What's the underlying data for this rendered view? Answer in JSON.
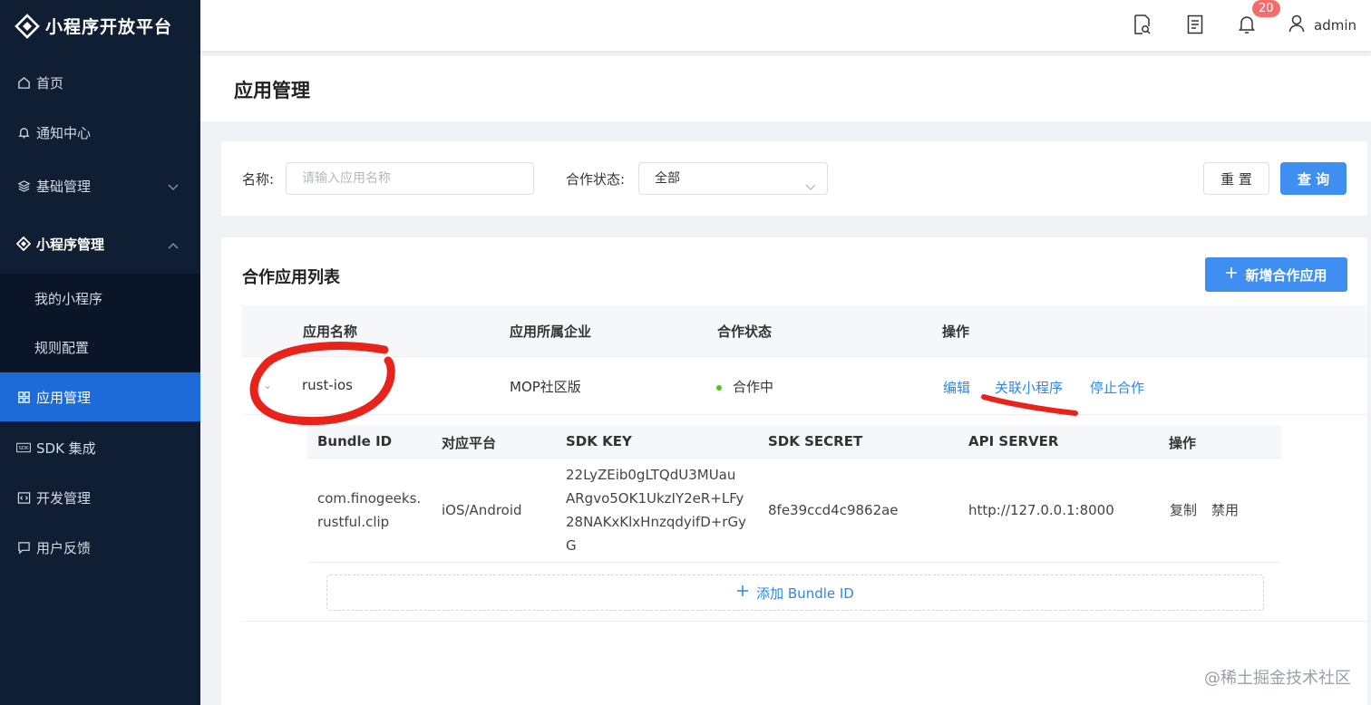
{
  "brand": {
    "title": "小程序开放平台"
  },
  "sidebar": {
    "items": [
      {
        "label": "首页",
        "icon": "home-icon"
      },
      {
        "label": "通知中心",
        "icon": "bell-icon"
      },
      {
        "label": "基础管理",
        "icon": "layers-icon"
      },
      {
        "label": "小程序管理",
        "icon": "miniprogram-icon"
      },
      {
        "label": "我的小程序"
      },
      {
        "label": "规则配置"
      },
      {
        "label": "应用管理",
        "icon": "grid-icon"
      },
      {
        "label": "SDK 集成",
        "icon": "sdk-icon"
      },
      {
        "label": "开发管理",
        "icon": "code-icon"
      },
      {
        "label": "用户反馈",
        "icon": "feedback-icon"
      }
    ]
  },
  "header": {
    "notification_count": "20",
    "username": "admin"
  },
  "page": {
    "title": "应用管理"
  },
  "filter": {
    "name_label": "名称:",
    "name_placeholder": "请输入应用名称",
    "status_label": "合作状态:",
    "status_value": "全部",
    "reset_label": "重 置",
    "query_label": "查 询"
  },
  "list": {
    "title": "合作应用列表",
    "add_label": "新增合作应用",
    "columns": [
      "应用名称",
      "应用所属企业",
      "合作状态",
      "操作"
    ],
    "row": {
      "name": "rust-ios",
      "company": "MOP社区版",
      "status": "合作中",
      "actions": [
        "编辑",
        "关联小程序",
        "停止合作"
      ]
    }
  },
  "bundle_table": {
    "columns": [
      "Bundle ID",
      "对应平台",
      "SDK KEY",
      "SDK SECRET",
      "API SERVER",
      "操作"
    ],
    "row": {
      "bundle_id_line1": "com.finogeeks.",
      "bundle_id_line2": "rustful.clip",
      "platform": "iOS/Android",
      "sdk_key_lines": [
        "22LyZEib0gLTQdU3MUau",
        "ARgvo5OK1UkzIY2eR+LFy",
        "28NAKxKlxHnzqdyifD+rGy",
        "G"
      ],
      "sdk_secret": "8fe39ccd4c9862ae",
      "api_server": "http://127.0.0.1:8000",
      "copy_label": "复制",
      "disable_label": "禁用"
    },
    "add_label": "添加 Bundle ID"
  },
  "watermark": "@稀土掘金技术社区",
  "colors": {
    "sidebar_bg": "#0f1e33",
    "primary": "#3f8ff2",
    "danger": "#e2483d",
    "annotation": "#e8231c"
  }
}
